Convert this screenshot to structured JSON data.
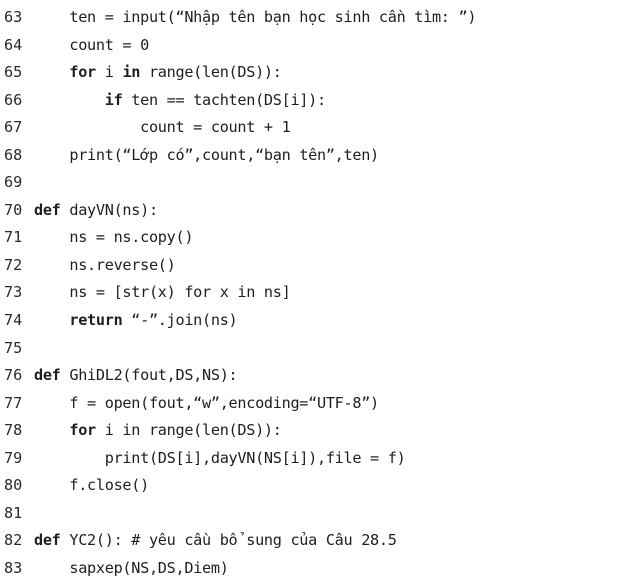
{
  "code": {
    "language": "python",
    "lines": [
      {
        "number": "63",
        "text": "    ten = input(“Nhập tên bạn học sinh cần tìm: ”)"
      },
      {
        "number": "64",
        "text": "    count = 0"
      },
      {
        "number": "65",
        "text": "    for i in range(len(DS)):"
      },
      {
        "number": "66",
        "text": "        if ten == tachten(DS[i]):"
      },
      {
        "number": "67",
        "text": "            count = count + 1"
      },
      {
        "number": "68",
        "text": "    print(“Lớp có”,count,“bạn tên”,ten)"
      },
      {
        "number": "69",
        "text": ""
      },
      {
        "number": "70",
        "text": "def dayVN(ns):"
      },
      {
        "number": "71",
        "text": "    ns = ns.copy()"
      },
      {
        "number": "72",
        "text": "    ns.reverse()"
      },
      {
        "number": "73",
        "text": "    ns = [str(x) for x in ns]"
      },
      {
        "number": "74",
        "text": "    return “-”.join(ns)"
      },
      {
        "number": "75",
        "text": ""
      },
      {
        "number": "76",
        "text": "def GhiDL2(fout,DS,NS):"
      },
      {
        "number": "77",
        "text": "    f = open(fout,“w”,encoding=“UTF-8”)"
      },
      {
        "number": "78",
        "text": "    for i in range(len(DS)):"
      },
      {
        "number": "79",
        "text": "        print(DS[i],dayVN(NS[i]),file = f)"
      },
      {
        "number": "80",
        "text": "    f.close()"
      },
      {
        "number": "81",
        "text": ""
      },
      {
        "number": "82",
        "text": "def YC2(): # yêu cầu bổ sung của Câu 28.5"
      },
      {
        "number": "83",
        "text": "    sapxep(NS,DS,Diem)"
      }
    ],
    "keywords": [
      "def",
      "for",
      "in",
      "if",
      "return"
    ]
  }
}
